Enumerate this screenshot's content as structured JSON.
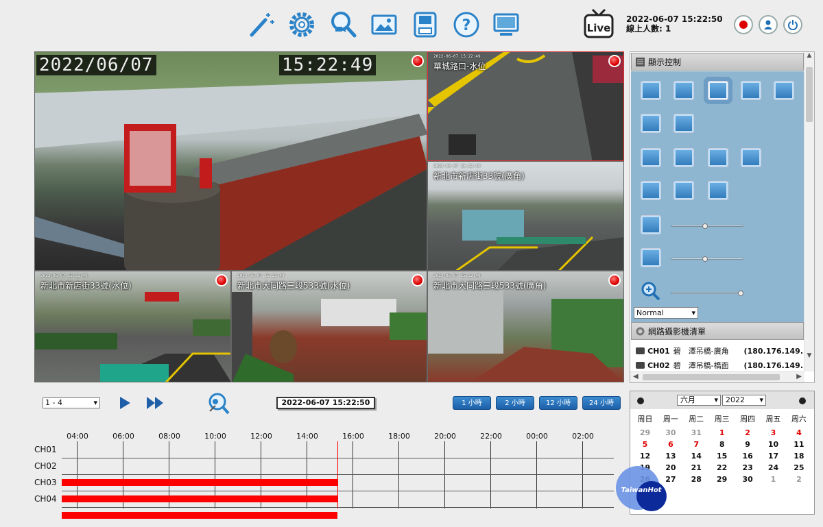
{
  "toolbar": {
    "icons": [
      "magic-wand-icon",
      "settings-icon",
      "playback-search-icon",
      "image-icon",
      "save-icon",
      "help-icon",
      "monitor-icon"
    ],
    "live_label": "Live",
    "datetime": "2022-06-07 15:22:50",
    "online_users": "線上人數: 1",
    "accent": "#1f6fb5"
  },
  "video": {
    "main": {
      "date": "2022/06/07",
      "time": "15:22:49"
    },
    "cams": [
      {
        "loc": "華城路口-水位",
        "ts": "2022-06-07  15:22:49"
      },
      {
        "loc": "新北市新店街33號(廣角)",
        "ts": "2022-06-07  15:22:49"
      },
      {
        "loc": "新北市新店街33號(水位)",
        "ts": "2022-06-07  15:22:49"
      },
      {
        "loc": "新北市大同路三段533號(水位)",
        "ts": "2022-06-07  15:22:49"
      },
      {
        "loc": "新北市大同路三段533號(廣角)",
        "ts": "2022-06-07  15:22:49"
      }
    ]
  },
  "display_control": {
    "title": "顯示控制",
    "mode": "Normal"
  },
  "camera_list": {
    "title": "網路攝影機清單",
    "items": [
      {
        "ch": "CH01",
        "name": "碧　潭吊橋-廣角",
        "ip": "(180.176.149."
      },
      {
        "ch": "CH02",
        "name": "碧　潭吊橋-橋面",
        "ip": "(180.176.149."
      }
    ]
  },
  "playback": {
    "range": "1 - 4",
    "time": "2022-06-07 15:22:50",
    "buttons": [
      "1 小時",
      "2 小時",
      "12 小時",
      "24 小時"
    ]
  },
  "timeline": {
    "hours": [
      "04:00",
      "06:00",
      "08:00",
      "10:00",
      "12:00",
      "14:00",
      "16:00",
      "18:00",
      "20:00",
      "22:00",
      "00:00",
      "02:00"
    ],
    "channels": [
      "CH01",
      "CH02",
      "CH03",
      "CH04"
    ],
    "recorded_fraction": [
      0,
      0.5,
      0.5,
      0.5
    ],
    "record_color": "#ff0000"
  },
  "calendar": {
    "month": "六月",
    "year": "2022",
    "dow": [
      "周日",
      "周一",
      "周二",
      "周三",
      "周四",
      "周五",
      "周六"
    ],
    "weeks": [
      [
        "29",
        "30",
        "31",
        "1",
        "2",
        "3",
        "4"
      ],
      [
        "5",
        "6",
        "7",
        "8",
        "9",
        "10",
        "11"
      ],
      [
        "12",
        "13",
        "14",
        "15",
        "16",
        "17",
        "18"
      ],
      [
        "19",
        "20",
        "21",
        "22",
        "23",
        "24",
        "25"
      ],
      [
        "26",
        "27",
        "28",
        "29",
        "30",
        "1",
        "2"
      ]
    ]
  },
  "watermark": "TaiwanHot"
}
